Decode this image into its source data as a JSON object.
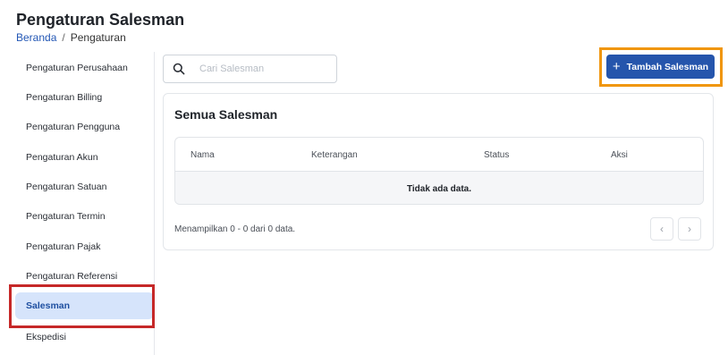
{
  "header": {
    "title": "Pengaturan Salesman",
    "breadcrumb": {
      "home": "Beranda",
      "separator": "/",
      "current": "Pengaturan"
    }
  },
  "sidebar": {
    "items": [
      {
        "label": "Pengaturan Perusahaan",
        "active": false
      },
      {
        "label": "Pengaturan Billing",
        "active": false
      },
      {
        "label": "Pengaturan Pengguna",
        "active": false
      },
      {
        "label": "Pengaturan Akun",
        "active": false
      },
      {
        "label": "Pengaturan Satuan",
        "active": false
      },
      {
        "label": "Pengaturan Termin",
        "active": false
      },
      {
        "label": "Pengaturan Pajak",
        "active": false
      },
      {
        "label": "Pengaturan Referensi",
        "active": false
      },
      {
        "label": "Salesman",
        "active": true
      },
      {
        "label": "Ekspedisi",
        "active": false
      }
    ]
  },
  "search": {
    "placeholder": "Cari Salesman",
    "value": "",
    "icon": "search-icon"
  },
  "toolbar": {
    "add_label": "Tambah Salesman",
    "add_icon": "plus-icon"
  },
  "card": {
    "title": "Semua Salesman",
    "columns": [
      "Nama",
      "Keterangan",
      "Status",
      "Aksi"
    ],
    "empty_text": "Tidak ada data.",
    "footer": "Menampilkan 0 - 0 dari 0 data.",
    "pager": {
      "prev_icon": "chevron-left-icon",
      "next_icon": "chevron-right-icon"
    }
  },
  "colors": {
    "primary": "#2555ac",
    "active_bg": "#d6e4fb",
    "highlight_red": "#c62828",
    "highlight_orange": "#f0960e",
    "link": "#2357b5"
  }
}
